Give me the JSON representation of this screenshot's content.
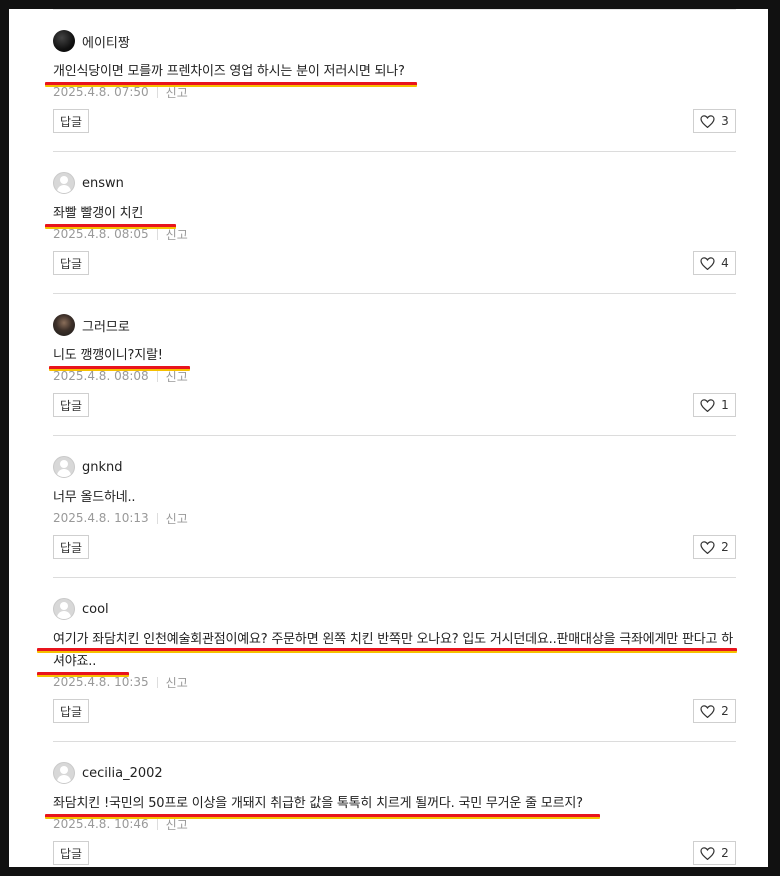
{
  "comments": [
    {
      "nickname": "에이티짱",
      "text": "개인식당이면 모를까 프렌차이즈 영업 하시는 분이 저러시면 되나?",
      "date": "2025.4.8. 07:50",
      "report_label": "신고",
      "reply_label": "답글",
      "likes": "3",
      "avatar": "dark"
    },
    {
      "nickname": "enswn",
      "text": "좌빨 빨갱이 치킨",
      "date": "2025.4.8. 08:05",
      "report_label": "신고",
      "reply_label": "답글",
      "likes": "4",
      "avatar": "default"
    },
    {
      "nickname": "그러므로",
      "text": "니도 깽깽이니?지랄!",
      "date": "2025.4.8. 08:08",
      "report_label": "신고",
      "reply_label": "답글",
      "likes": "1",
      "avatar": "photo"
    },
    {
      "nickname": "gnknd",
      "text": "너무 올드하네..",
      "date": "2025.4.8. 10:13",
      "report_label": "신고",
      "reply_label": "답글",
      "likes": "2",
      "avatar": "default"
    },
    {
      "nickname": "cool",
      "text": "여기가 좌담치킨 인천예술회관점이예요? 주문하면 왼쪽 치킨 반쪽만 오나요? 입도 거시던데요..판매대상을 극좌에게만 판다고 하셔야죠..",
      "date": "2025.4.8. 10:35",
      "report_label": "신고",
      "reply_label": "답글",
      "likes": "2",
      "avatar": "default"
    },
    {
      "nickname": "cecilia_2002",
      "text": "좌담치킨 !국민의 50프로 이상을 개돼지 취급한 값을 톡톡히 치르게 될꺼다. 국민 무거운 줄 모르지?",
      "date": "2025.4.8. 10:46",
      "report_label": "신고",
      "reply_label": "답글",
      "likes": "2",
      "avatar": "default"
    }
  ],
  "colors": {
    "underline_red": "#e8141d",
    "underline_yellow": "#f6c000"
  },
  "icons": {
    "like": "heart-outline-icon"
  }
}
